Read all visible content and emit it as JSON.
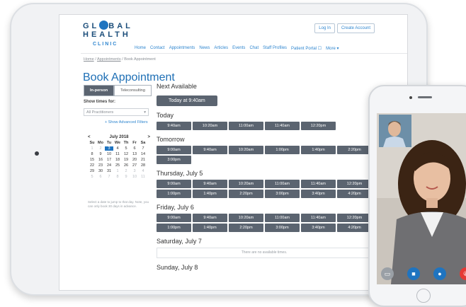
{
  "logo": {
    "line1": "GL",
    "line1b": "BAL",
    "line2": "HEALTH",
    "line3": "CLINIC"
  },
  "header": {
    "login": "Log In",
    "create": "Create Account"
  },
  "nav": [
    "Home",
    "Contact",
    "Appointments",
    "News",
    "Articles",
    "Events",
    "Chat",
    "Staff Profiles",
    "Patient Portal ☐",
    "More ▾"
  ],
  "breadcrumb": {
    "home": "Home",
    "sep1": " / ",
    "appointments": "Appointments",
    "sep2": " / ",
    "current": "Book Appointment"
  },
  "page_title": "Book Appointment",
  "sidebar": {
    "tab_inperson": "In-person",
    "tab_tele": "Teleconsulting",
    "show_for": "Show times for:",
    "practitioner": "All Practitioners",
    "advanced": "+ Show Advanced Filters",
    "cal_month": "July 2018",
    "cal_prev": "<",
    "cal_next": ">",
    "days": [
      "Su",
      "Mo",
      "Tu",
      "We",
      "Th",
      "Fr",
      "Sa"
    ],
    "note": "Select a date to jump to that day. Note, you can only book 30 days in advance."
  },
  "next_available": {
    "title": "Next Available",
    "button": "Today at 9:40am"
  },
  "days": [
    {
      "title": "Today",
      "slots": [
        "9:40am",
        "10:20am",
        "11:00am",
        "11:40am",
        "12:20pm"
      ]
    },
    {
      "title": "Tomorrow",
      "slots": [
        "9:00am",
        "9:40am",
        "10:20am",
        "1:00pm",
        "1:40pm",
        "2:20pm",
        "3:00pm"
      ]
    },
    {
      "title": "Thursday, July 5",
      "slots": [
        "9:00am",
        "9:40am",
        "10:20am",
        "11:00am",
        "11:40am",
        "12:20pm",
        "1:00pm",
        "1:40pm",
        "2:20pm",
        "3:00pm",
        "3:40pm",
        "4:20pm"
      ]
    },
    {
      "title": "Friday, July 6",
      "slots": [
        "9:00am",
        "9:40am",
        "10:20am",
        "11:00am",
        "11:40am",
        "12:20pm",
        "1:00pm",
        "1:40pm",
        "2:20pm",
        "3:00pm",
        "3:40pm",
        "4:20pm"
      ]
    },
    {
      "title": "Saturday, July 7",
      "empty": "There are no available times."
    },
    {
      "title": "Sunday, July 8"
    }
  ],
  "colors": {
    "brand": "#1f74c0",
    "slot": "#5b6470"
  }
}
